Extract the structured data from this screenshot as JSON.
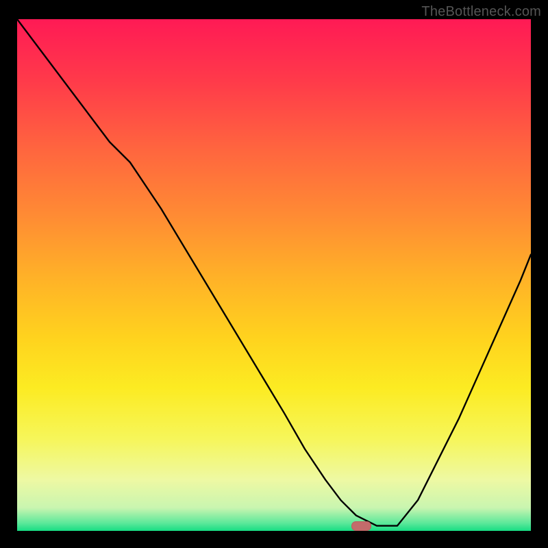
{
  "watermark": "TheBottleneck.com",
  "colors": {
    "page_bg": "#000000",
    "curve": "#000000",
    "marker_fill": "#c36b6b",
    "marker_stroke": "#b85f5f",
    "gradient_stops": [
      {
        "offset": 0.0,
        "color": "#ff1a55"
      },
      {
        "offset": 0.12,
        "color": "#ff3a4a"
      },
      {
        "offset": 0.25,
        "color": "#ff643f"
      },
      {
        "offset": 0.38,
        "color": "#ff8a34"
      },
      {
        "offset": 0.5,
        "color": "#ffb028"
      },
      {
        "offset": 0.62,
        "color": "#ffd21e"
      },
      {
        "offset": 0.72,
        "color": "#fceb22"
      },
      {
        "offset": 0.82,
        "color": "#f6f65a"
      },
      {
        "offset": 0.9,
        "color": "#eef9a3"
      },
      {
        "offset": 0.955,
        "color": "#c9f5b0"
      },
      {
        "offset": 0.985,
        "color": "#5be89a"
      },
      {
        "offset": 1.0,
        "color": "#17dd83"
      }
    ]
  },
  "chart_data": {
    "type": "line",
    "title": "",
    "xlabel": "",
    "ylabel": "",
    "xlim": [
      0,
      100
    ],
    "ylim": [
      0,
      100
    ],
    "x": [
      0,
      6,
      12,
      18,
      22,
      28,
      34,
      40,
      46,
      52,
      56,
      60,
      63,
      66,
      70,
      74,
      78,
      82,
      86,
      90,
      94,
      98,
      100
    ],
    "values": [
      100,
      92,
      84,
      76,
      72,
      63,
      53,
      43,
      33,
      23,
      16,
      10,
      6,
      3,
      1,
      1,
      6,
      14,
      22,
      31,
      40,
      49,
      54
    ],
    "marker": {
      "x": 67,
      "y": 1
    },
    "annotations": []
  }
}
